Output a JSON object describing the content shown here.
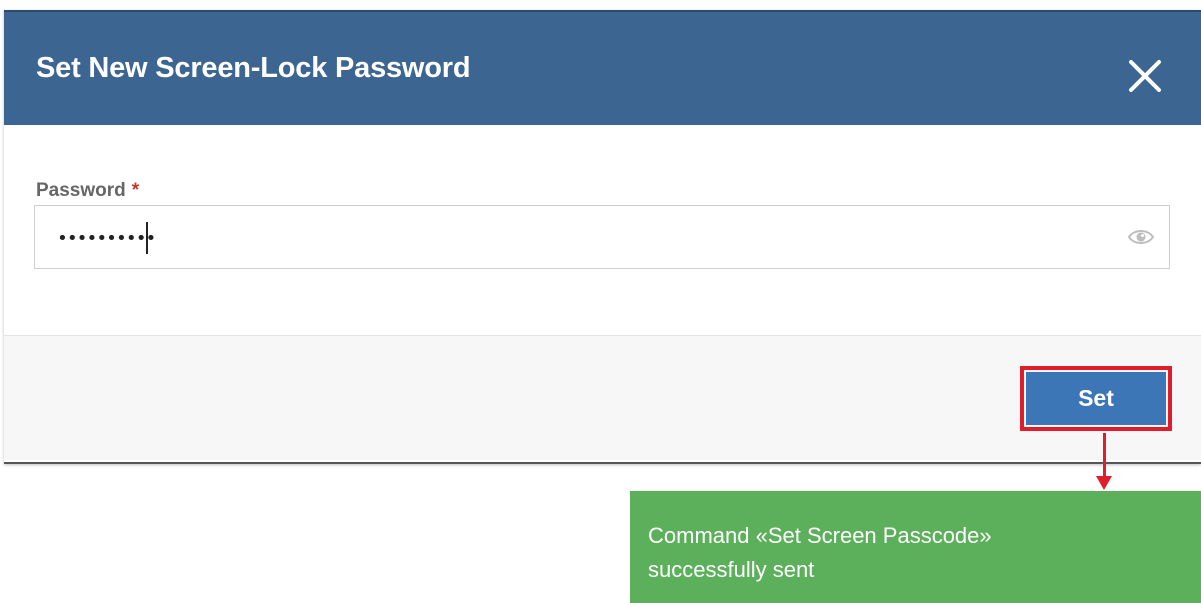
{
  "dialog": {
    "title": "Set New Screen-Lock Password",
    "close_icon": "close-icon"
  },
  "form": {
    "password_label": "Password",
    "required_marker": "*",
    "password_value": "••••••••••",
    "eye_icon": "eye-icon"
  },
  "footer": {
    "set_label": "Set"
  },
  "toast": {
    "line1": "Command «Set Screen Passcode»",
    "line2": "successfully sent"
  },
  "colors": {
    "header": "#3c6592",
    "set_button": "#3c76b6",
    "highlight": "#e01e2b",
    "toast": "#5db05b"
  }
}
